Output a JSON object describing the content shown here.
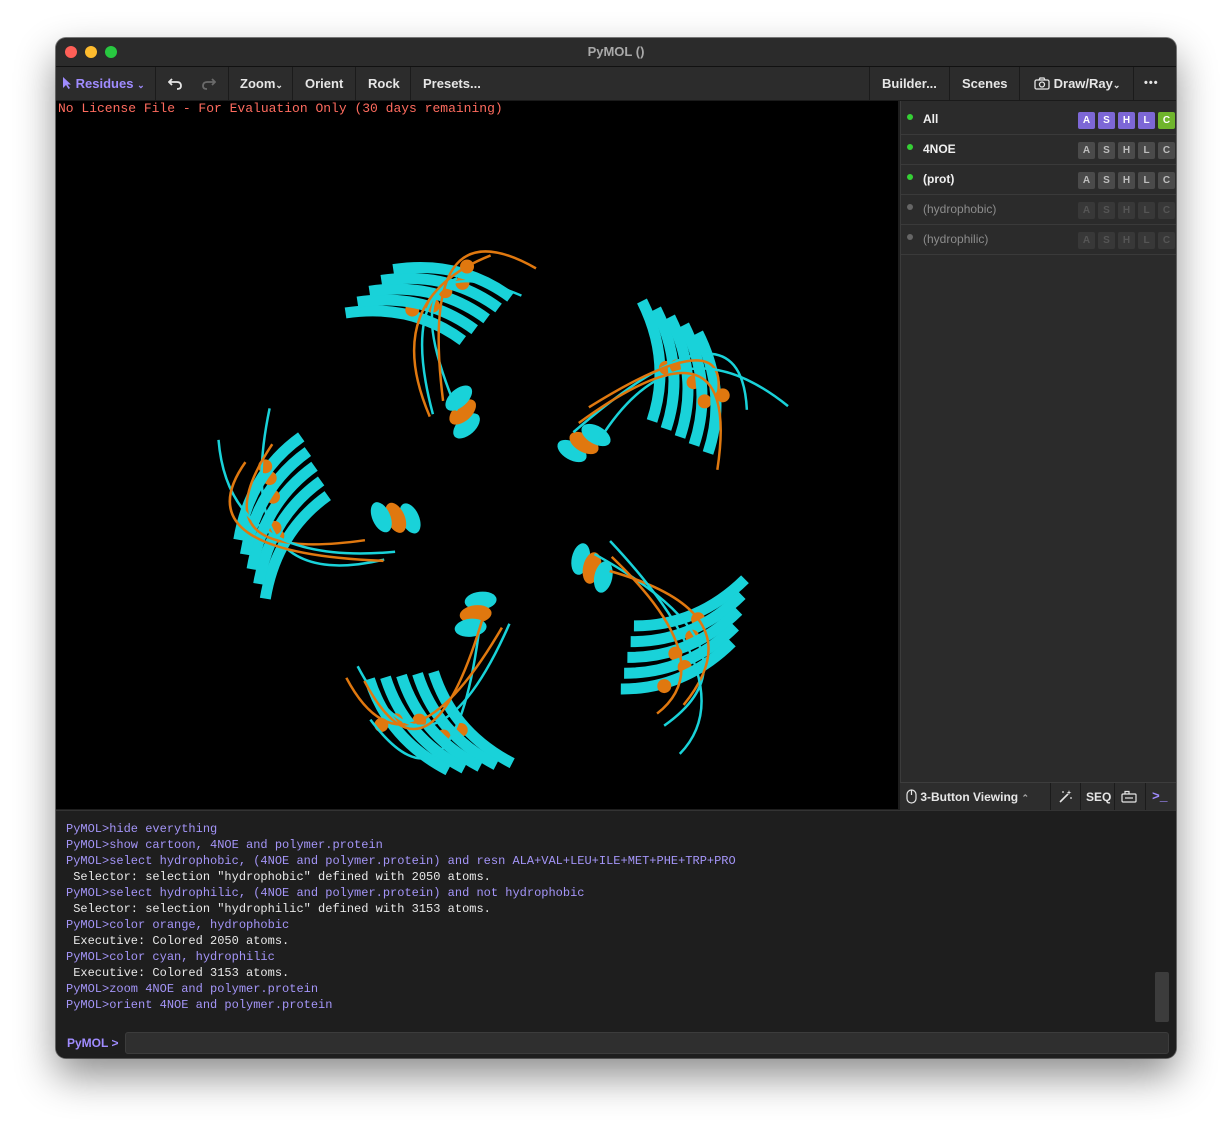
{
  "window": {
    "title": "PyMOL ()"
  },
  "toolbar": {
    "mode_label": "Residues",
    "zoom_label": "Zoom",
    "orient_label": "Orient",
    "rock_label": "Rock",
    "presets_label": "Presets...",
    "builder_label": "Builder...",
    "scenes_label": "Scenes",
    "drawray_label": "Draw/Ray",
    "more_label": "•••"
  },
  "viewport": {
    "license_text": "No License File - For Evaluation Only (30 days remaining)"
  },
  "objects": [
    {
      "name": "All",
      "buttons": [
        "A",
        "S",
        "H",
        "L",
        "C"
      ],
      "style": "highlight",
      "enabled": true
    },
    {
      "name": "4NOE",
      "buttons": [
        "A",
        "S",
        "H",
        "L",
        "C"
      ],
      "style": "normal",
      "enabled": true
    },
    {
      "name": "(prot)",
      "buttons": [
        "A",
        "S",
        "H",
        "L",
        "C"
      ],
      "style": "normal",
      "enabled": true
    },
    {
      "name": "(hydrophobic)",
      "buttons": [
        "A",
        "S",
        "H",
        "L",
        "C"
      ],
      "style": "faded",
      "enabled": false
    },
    {
      "name": "(hydrophilic)",
      "buttons": [
        "A",
        "S",
        "H",
        "L",
        "C"
      ],
      "style": "faded",
      "enabled": false
    }
  ],
  "bottom_bar": {
    "viewing_label": "3-Button Viewing",
    "seq_label": "SEQ",
    "console_icon": ">_"
  },
  "console": {
    "lines": [
      {
        "type": "cmd",
        "text": "PyMOL>hide everything"
      },
      {
        "type": "cmd",
        "text": "PyMOL>show cartoon, 4NOE and polymer.protein"
      },
      {
        "type": "cmd",
        "text": "PyMOL>select hydrophobic, (4NOE and polymer.protein) and resn ALA+VAL+LEU+ILE+MET+PHE+TRP+PRO"
      },
      {
        "type": "out",
        "text": " Selector: selection \"hydrophobic\" defined with 2050 atoms."
      },
      {
        "type": "cmd",
        "text": "PyMOL>select hydrophilic, (4NOE and polymer.protein) and not hydrophobic"
      },
      {
        "type": "out",
        "text": " Selector: selection \"hydrophilic\" defined with 3153 atoms."
      },
      {
        "type": "cmd",
        "text": "PyMOL>color orange, hydrophobic"
      },
      {
        "type": "out",
        "text": " Executive: Colored 2050 atoms."
      },
      {
        "type": "cmd",
        "text": "PyMOL>color cyan, hydrophilic"
      },
      {
        "type": "out",
        "text": " Executive: Colored 3153 atoms."
      },
      {
        "type": "cmd",
        "text": "PyMOL>zoom 4NOE and polymer.protein"
      },
      {
        "type": "cmd",
        "text": "PyMOL>orient 4NOE and polymer.protein"
      }
    ],
    "prompt": "PyMOL >",
    "input_value": ""
  },
  "colors": {
    "hydrophobic": "#e0780f",
    "hydrophilic": "#19d2d9",
    "accent": "#a08cff"
  }
}
